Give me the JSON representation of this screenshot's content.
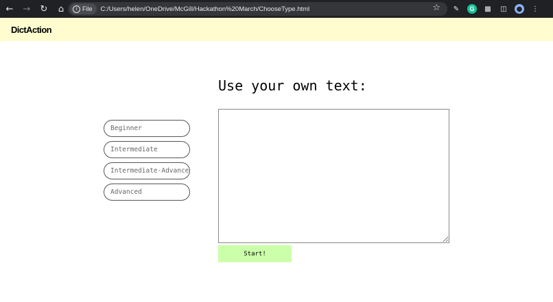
{
  "browser": {
    "url_chip": "File",
    "url": "C:/Users/helen/OneDrive/McGill/Hackathon%20March/ChooseType.html"
  },
  "app": {
    "logo": "DictAction"
  },
  "main": {
    "title": "Use your own text:",
    "levels": [
      {
        "label": "Beginner"
      },
      {
        "label": "Intermediate"
      },
      {
        "label": "Intermediate-Advanced"
      },
      {
        "label": "Advanced"
      }
    ],
    "text_input": {
      "value": "",
      "placeholder": ""
    },
    "start_label": "Start!"
  },
  "colors": {
    "header_bg": "#fffdd0",
    "start_bg": "#ccffaa",
    "chrome_bg": "#202124"
  }
}
